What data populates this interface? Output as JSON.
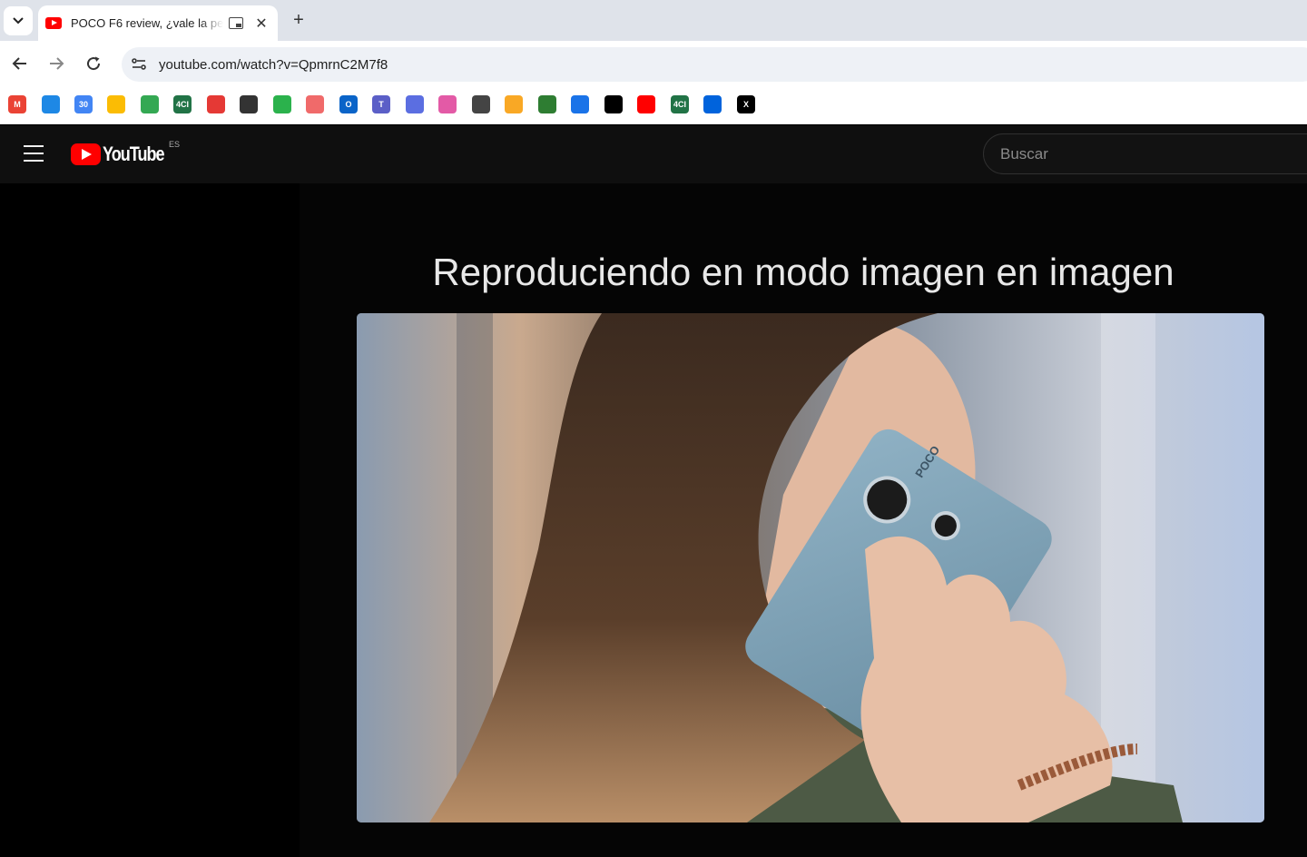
{
  "browser": {
    "tab": {
      "title": "POCO F6 review, ¿vale la pe"
    },
    "new_tab": "+",
    "close": "✕",
    "url": "youtube.com/watch?v=QpmrnC2M7f8",
    "bookmarks": [
      {
        "icon": "gmail-icon",
        "label": "M",
        "color": "#ea4335"
      },
      {
        "icon": "drive-icon",
        "label": "",
        "color": "#1e88e5"
      },
      {
        "icon": "calendar-icon",
        "label": "30",
        "color": "#4285f4"
      },
      {
        "icon": "keep-icon",
        "label": "",
        "color": "#fbbc04"
      },
      {
        "icon": "photos-icon",
        "label": "",
        "color": "#34a853"
      },
      {
        "icon": "4ci-icon",
        "label": "4CI",
        "color": "#217346"
      },
      {
        "icon": "record-icon",
        "label": "",
        "color": "#e53935"
      },
      {
        "icon": "globe-icon",
        "label": "",
        "color": "#333333"
      },
      {
        "icon": "feedly-icon",
        "label": "",
        "color": "#2bb24c"
      },
      {
        "icon": "asana-icon",
        "label": "",
        "color": "#f06a6a"
      },
      {
        "icon": "outlook-icon",
        "label": "O",
        "color": "#0a64c8"
      },
      {
        "icon": "teams-icon",
        "label": "T",
        "color": "#5b5fc7"
      },
      {
        "icon": "copilot-icon",
        "label": "",
        "color": "#5b6ee1"
      },
      {
        "icon": "copilot-color-icon",
        "label": "",
        "color": "#e35aa6"
      },
      {
        "icon": "chatgpt-icon",
        "label": "",
        "color": "#444444"
      },
      {
        "icon": "pencil-icon",
        "label": "",
        "color": "#f9a825"
      },
      {
        "icon": "trend-icon",
        "label": "",
        "color": "#2e7d32"
      },
      {
        "icon": "magnifier-icon",
        "label": "",
        "color": "#1a73e8"
      },
      {
        "icon": "tiktok-icon",
        "label": "",
        "color": "#000000"
      },
      {
        "icon": "youtube-icon",
        "label": "",
        "color": "#ff0000"
      },
      {
        "icon": "4ci-icon",
        "label": "4CI",
        "color": "#217346"
      },
      {
        "icon": "flickr-icon",
        "label": "",
        "color": "#0063dc"
      },
      {
        "icon": "x-icon",
        "label": "X",
        "color": "#000000"
      }
    ]
  },
  "youtube": {
    "logo_text": "YouTube",
    "country": "ES",
    "search_placeholder": "Buscar",
    "pip_message": "Reproduciendo en modo imagen en imagen",
    "phone_brand": "POCO"
  },
  "colors": {
    "header_bg": "#0f0f0f",
    "brand_red": "#ff0000"
  }
}
